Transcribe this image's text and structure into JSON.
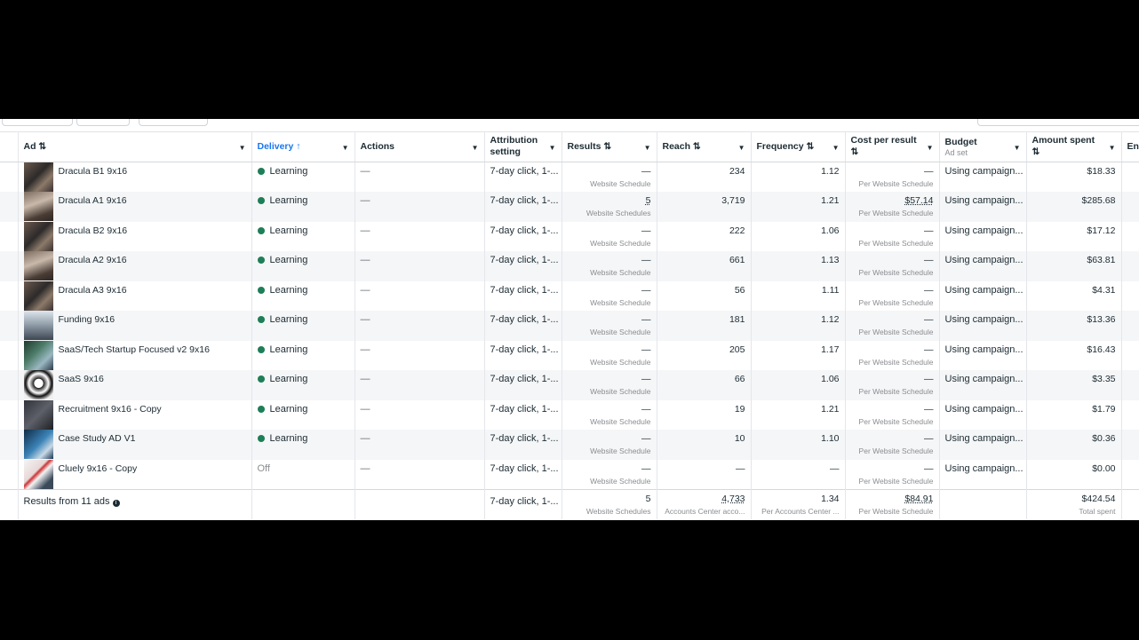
{
  "columns": {
    "ad": "Ad ⇅",
    "delivery": "Delivery ↑",
    "actions": "Actions",
    "attribution": "Attribution setting",
    "results": "Results ⇅",
    "reach": "Reach ⇅",
    "frequency": "Frequency ⇅",
    "cost": "Cost per result ⇅",
    "budget": "Budget",
    "budget_sub": "Ad set",
    "amount": "Amount spent ⇅",
    "ends": "En"
  },
  "rows": [
    {
      "ad": "Dracula B1 9x16",
      "delivery": "Learning",
      "actions": "—",
      "attribution": "7-day click, 1-...",
      "results": "—",
      "results_sub": "Website Schedule",
      "reach": "234",
      "frequency": "1.12",
      "cost": "—",
      "cost_sub": "Per Website Schedule",
      "budget": "Using campaign...",
      "amount": "$18.33"
    },
    {
      "ad": "Dracula A1 9x16",
      "delivery": "Learning",
      "actions": "—",
      "attribution": "7-day click, 1-...",
      "results": "5",
      "results_sub": "Website Schedules",
      "reach": "3,719",
      "frequency": "1.21",
      "cost": "$57.14",
      "cost_sub": "Per Website Schedule",
      "budget": "Using campaign...",
      "amount": "$285.68"
    },
    {
      "ad": "Dracula B2 9x16",
      "delivery": "Learning",
      "actions": "—",
      "attribution": "7-day click, 1-...",
      "results": "—",
      "results_sub": "Website Schedule",
      "reach": "222",
      "frequency": "1.06",
      "cost": "—",
      "cost_sub": "Per Website Schedule",
      "budget": "Using campaign...",
      "amount": "$17.12"
    },
    {
      "ad": "Dracula A2 9x16",
      "delivery": "Learning",
      "actions": "—",
      "attribution": "7-day click, 1-...",
      "results": "—",
      "results_sub": "Website Schedule",
      "reach": "661",
      "frequency": "1.13",
      "cost": "—",
      "cost_sub": "Per Website Schedule",
      "budget": "Using campaign...",
      "amount": "$63.81"
    },
    {
      "ad": "Dracula A3 9x16",
      "delivery": "Learning",
      "actions": "—",
      "attribution": "7-day click, 1-...",
      "results": "—",
      "results_sub": "Website Schedule",
      "reach": "56",
      "frequency": "1.11",
      "cost": "—",
      "cost_sub": "Per Website Schedule",
      "budget": "Using campaign...",
      "amount": "$4.31"
    },
    {
      "ad": "Funding 9x16",
      "delivery": "Learning",
      "actions": "—",
      "attribution": "7-day click, 1-...",
      "results": "—",
      "results_sub": "Website Schedule",
      "reach": "181",
      "frequency": "1.12",
      "cost": "—",
      "cost_sub": "Per Website Schedule",
      "budget": "Using campaign...",
      "amount": "$13.36"
    },
    {
      "ad": "SaaS/Tech Startup Focused v2 9x16",
      "delivery": "Learning",
      "actions": "—",
      "attribution": "7-day click, 1-...",
      "results": "—",
      "results_sub": "Website Schedule",
      "reach": "205",
      "frequency": "1.17",
      "cost": "—",
      "cost_sub": "Per Website Schedule",
      "budget": "Using campaign...",
      "amount": "$16.43"
    },
    {
      "ad": "SaaS 9x16",
      "delivery": "Learning",
      "actions": "—",
      "attribution": "7-day click, 1-...",
      "results": "—",
      "results_sub": "Website Schedule",
      "reach": "66",
      "frequency": "1.06",
      "cost": "—",
      "cost_sub": "Per Website Schedule",
      "budget": "Using campaign...",
      "amount": "$3.35"
    },
    {
      "ad": "Recruitment 9x16 - Copy",
      "delivery": "Learning",
      "actions": "—",
      "attribution": "7-day click, 1-...",
      "results": "—",
      "results_sub": "Website Schedule",
      "reach": "19",
      "frequency": "1.21",
      "cost": "—",
      "cost_sub": "Per Website Schedule",
      "budget": "Using campaign...",
      "amount": "$1.79"
    },
    {
      "ad": "Case Study AD V1",
      "delivery": "Learning",
      "actions": "—",
      "attribution": "7-day click, 1-...",
      "results": "—",
      "results_sub": "Website Schedule",
      "reach": "10",
      "frequency": "1.10",
      "cost": "—",
      "cost_sub": "Per Website Schedule",
      "budget": "Using campaign...",
      "amount": "$0.36"
    },
    {
      "ad": "Cluely 9x16 - Copy",
      "delivery": "Off",
      "actions": "—",
      "attribution": "7-day click, 1-...",
      "results": "—",
      "results_sub": "Website Schedule",
      "reach": "—",
      "frequency": "—",
      "cost": "—",
      "cost_sub": "Per Website Schedule",
      "budget": "Using campaign...",
      "amount": "$0.00"
    }
  ],
  "totals": {
    "label": "Results from 11 ads",
    "attribution": "7-day click, 1-...",
    "results": "5",
    "results_sub": "Website Schedules",
    "reach": "4,733",
    "reach_sub": "Accounts Center acco...",
    "frequency": "1.34",
    "frequency_sub": "Per Accounts Center ...",
    "cost": "$84.91",
    "cost_sub": "Per Website Schedule",
    "amount": "$424.54",
    "amount_sub": "Total spent"
  },
  "colors": {
    "learning": "#1d7e57",
    "active_header": "#1877f2"
  }
}
